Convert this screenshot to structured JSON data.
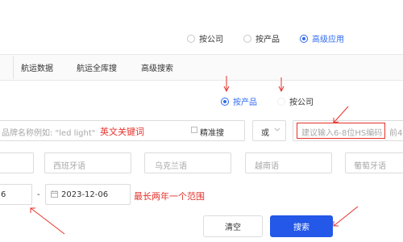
{
  "mode_radios": [
    {
      "label": "按公司",
      "selected": false
    },
    {
      "label": "按产品",
      "selected": false
    },
    {
      "label": "高级应用",
      "selected": true
    }
  ],
  "tabs": [
    "航运数据",
    "航运全库搜",
    "高级搜索"
  ],
  "search_by": [
    {
      "label": "按产品",
      "selected": true
    },
    {
      "label": "按公司",
      "selected": false
    }
  ],
  "keyword": {
    "placeholder": "品牌名称例如: \"led light\"",
    "annotation": "英文关键词",
    "exact_label": "精准搜"
  },
  "operator": {
    "value": "或",
    "chevron": "chevron-down-icon"
  },
  "hs_code": {
    "placeholder": "建议输入6-8位HS编码",
    "extra": "前4"
  },
  "languages": [
    "西班牙语",
    "乌克兰语",
    "越南语",
    "葡萄牙语"
  ],
  "date_range": {
    "start": "6",
    "separator": "-",
    "end": "2023-12-06",
    "annotation": "最长两年一个范围"
  },
  "buttons": {
    "clear": "清空",
    "search": "搜索"
  },
  "colors": {
    "primary": "#2358e8",
    "annotation_red": "#e5312a"
  }
}
